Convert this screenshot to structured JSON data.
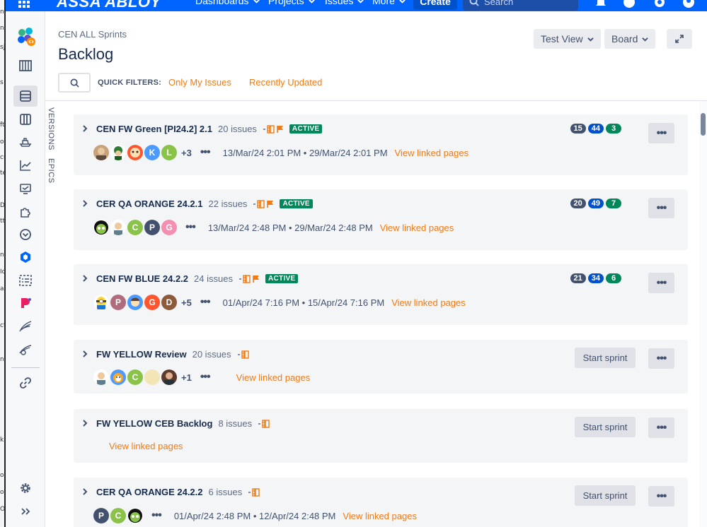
{
  "left_strip_chars": [
    "n",
    "n",
    "sj",
    "s",
    "ft",
    "ok",
    "cu",
    "te",
    "D",
    "tt",
    "ng",
    "Ic",
    "a",
    "ct",
    "n",
    "k",
    "o.",
    "o.",
    "O"
  ],
  "topnav": {
    "logo": "ASSA ABLOY",
    "items": [
      {
        "label": "Dashboards"
      },
      {
        "label": "Projects"
      },
      {
        "label": "Issues"
      },
      {
        "label": "More"
      }
    ],
    "create_label": "Create",
    "search_placeholder": "Search"
  },
  "header": {
    "breadcrumb": "CEN ALL Sprints",
    "title": "Backlog",
    "test_view_label": "Test View",
    "board_label": "Board"
  },
  "quick_filters": {
    "label": "QUICK FILTERS:",
    "filters": [
      "Only My Issues",
      "Recently Updated"
    ]
  },
  "vertical_tabs": [
    "VERSIONS",
    "EPICS"
  ],
  "colors": {
    "accent": "#0065ff",
    "link_orange": "#f27a13",
    "active_green": "#00875a"
  },
  "sprints": [
    {
      "name": "CEN FW Green [PI24.2] 2.1",
      "issue_count": "20 issues",
      "active": "ACTIVE",
      "extra_avatars": "+3",
      "dates": "13/Mar/24 2:01 PM • 29/Mar/24 2:01 PM",
      "view_linked": "View linked pages",
      "todo": "15",
      "in_progress": "44",
      "done": "3"
    },
    {
      "name": "CER QA ORANGE 24.2.1",
      "issue_count": "22 issues",
      "active": "ACTIVE",
      "extra_avatars": "",
      "dates": "13/Mar/24 2:48 PM • 29/Mar/24 2:48 PM",
      "view_linked": "View linked pages",
      "todo": "20",
      "in_progress": "49",
      "done": "7"
    },
    {
      "name": "CEN FW BLUE 24.2.2",
      "issue_count": "24 issues",
      "active": "ACTIVE",
      "extra_avatars": "+5",
      "dates": "01/Apr/24 7:16 PM • 15/Apr/24 7:16 PM",
      "view_linked": "View linked pages",
      "todo": "21",
      "in_progress": "34",
      "done": "6"
    },
    {
      "name": "FW YELLOW Review",
      "issue_count": "20 issues",
      "extra_avatars": "+1",
      "view_linked": "View linked pages",
      "start_label": "Start sprint"
    },
    {
      "name": "FW YELLOW CEB Backlog",
      "issue_count": "8 issues",
      "view_linked": "View linked pages",
      "start_label": "Start sprint"
    },
    {
      "name": "CER QA ORANGE 24.2.2",
      "issue_count": "6 issues",
      "dates": "01/Apr/24 2:48 PM • 12/Apr/24 2:48 PM",
      "view_linked": "View linked pages",
      "start_label": "Start sprint"
    }
  ],
  "avatar_letters": {
    "s1": [
      "K",
      "L"
    ],
    "s2": [
      "C",
      "P",
      "G"
    ],
    "s3": [
      "P",
      "G",
      "D"
    ],
    "s4": [
      "C"
    ],
    "s6": [
      "P",
      "C"
    ]
  }
}
